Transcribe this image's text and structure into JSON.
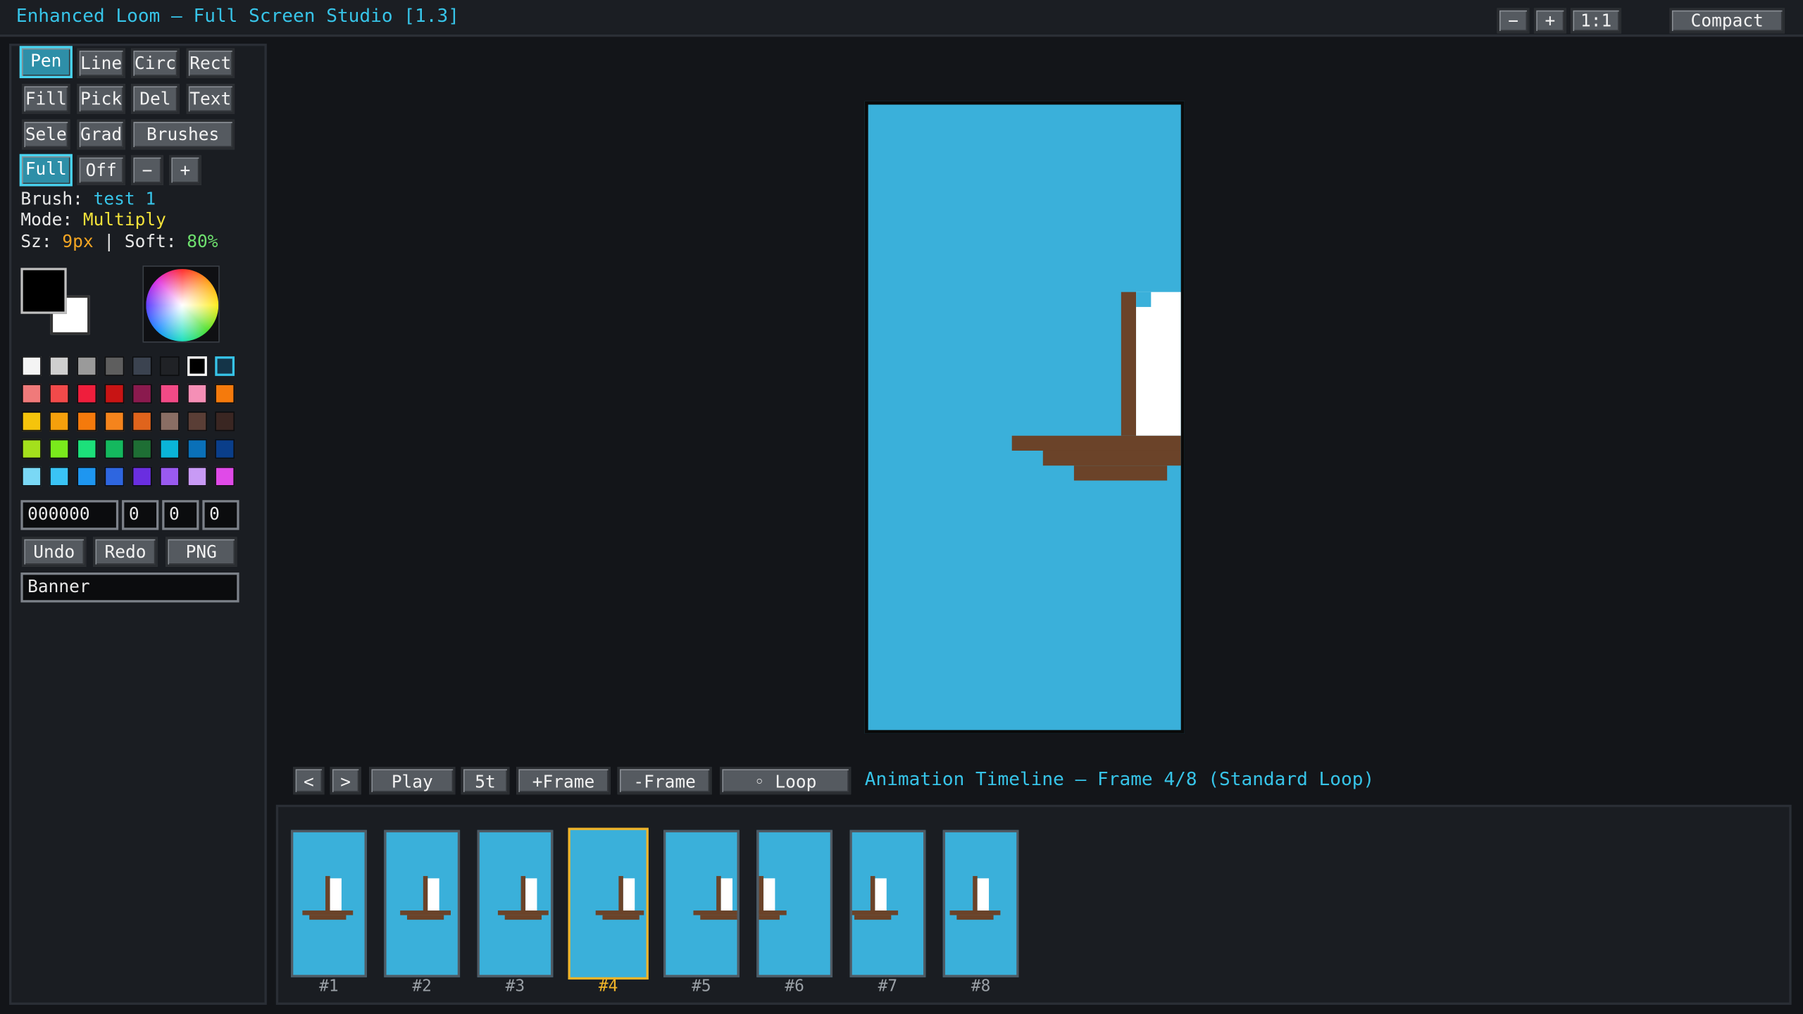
{
  "window": {
    "title": "Enhanced Loom — Full Screen Studio [1.3]",
    "zoom_out_label": "−",
    "zoom_in_label": "+",
    "zoom_reset_label": "1:1",
    "compact_label": "Compact"
  },
  "tools": {
    "pen": "Pen",
    "line": "Line",
    "circ": "Circ",
    "rect": "Rect",
    "fill": "Fill",
    "pick": "Pick",
    "del": "Del",
    "text": "Text",
    "select": "Sele",
    "grad": "Grad",
    "brushes": "Brushes",
    "full": "Full",
    "off": "Off",
    "size_down": "−",
    "size_up": "+"
  },
  "status": {
    "brush_label": "Brush: ",
    "brush_value": "test 1",
    "mode_label": "Mode: ",
    "mode_value": "Multiply",
    "size_label": "Sz: ",
    "size_value": "9px",
    "soft_label": " | Soft: ",
    "soft_value": "80%"
  },
  "colors": {
    "primary": "#000000",
    "secondary": "#ffffff",
    "hex_value": "000000",
    "r": "0",
    "g": "0",
    "b": "0",
    "palette": [
      "#f4f4f4",
      "#cfcfcf",
      "#9a9a9a",
      "#5e5e5e",
      "#3b4350",
      "#202226",
      "#000000",
      "#143448",
      "#f07a7a",
      "#f24a4a",
      "#ef1e3c",
      "#c81414",
      "#8a1a4e",
      "#f24a86",
      "#f58fb6",
      "#f57a0c",
      "#f5c40c",
      "#f5a00c",
      "#f57a0c",
      "#f5841c",
      "#e0641c",
      "#8a6e64",
      "#5a3e36",
      "#3a2622",
      "#a4e01c",
      "#7aea1c",
      "#1ce07a",
      "#14b85e",
      "#1e6e34",
      "#0ab4d8",
      "#0a70b8",
      "#0a3e8a",
      "#7ad8f5",
      "#3ac4f5",
      "#1e96f0",
      "#2e66e0",
      "#6a2ee0",
      "#9a5af0",
      "#c89af5",
      "#e04ae8"
    ]
  },
  "actions": {
    "undo": "Undo",
    "redo": "Redo",
    "png": "PNG",
    "name_value": "Banner"
  },
  "timeline": {
    "prev": "<",
    "next": ">",
    "play": "Play",
    "speed": "5t",
    "add_frame": "+Frame",
    "remove_frame": "-Frame",
    "loop": "◦ Loop",
    "label": "Animation Timeline — Frame 4/8 (Standard Loop)",
    "current_index": 4,
    "frames": [
      {
        "label": "#1"
      },
      {
        "label": "#2"
      },
      {
        "label": "#3"
      },
      {
        "label": "#4"
      },
      {
        "label": "#5"
      },
      {
        "label": "#6"
      },
      {
        "label": "#7"
      },
      {
        "label": "#8"
      }
    ]
  }
}
